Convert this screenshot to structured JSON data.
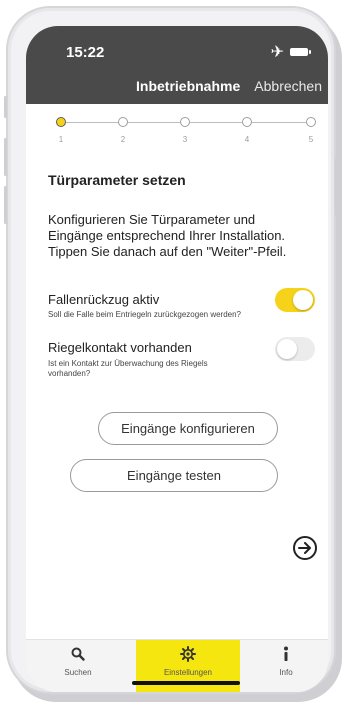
{
  "status_bar": {
    "time": "15:22"
  },
  "nav": {
    "title": "Inbetriebnahme",
    "cancel_label": "Abbrechen"
  },
  "stepper": {
    "steps": [
      "1",
      "2",
      "3",
      "4",
      "5"
    ],
    "active_step": 1
  },
  "content": {
    "title": "Türparameter setzen",
    "description": "Konfigurieren Sie Türparameter und Eingänge entsprechend Ihrer Installation. Tippen Sie danach auf den \"Weiter\"-Pfeil.",
    "toggles": [
      {
        "label": "Fallenrückzug aktiv",
        "sublabel": "Soll die Falle beim Entriegeln zurückgezogen werden?",
        "on": true
      },
      {
        "label": "Riegelkontakt vorhanden",
        "sublabel": "Ist ein Kontakt zur Überwachung des Riegels vorhanden?",
        "on": false
      }
    ],
    "buttons": {
      "configure": "Eingänge konfigurieren",
      "test": "Eingänge testen"
    }
  },
  "tabbar": {
    "tabs": [
      {
        "label": "Suchen",
        "icon": "search-icon"
      },
      {
        "label": "Einstellungen",
        "icon": "gear-icon",
        "active": true
      },
      {
        "label": "Info",
        "icon": "info-icon"
      }
    ]
  },
  "colors": {
    "accent": "#f6d21a",
    "header": "#4a4a4a",
    "active_tab": "#f6e60f"
  }
}
